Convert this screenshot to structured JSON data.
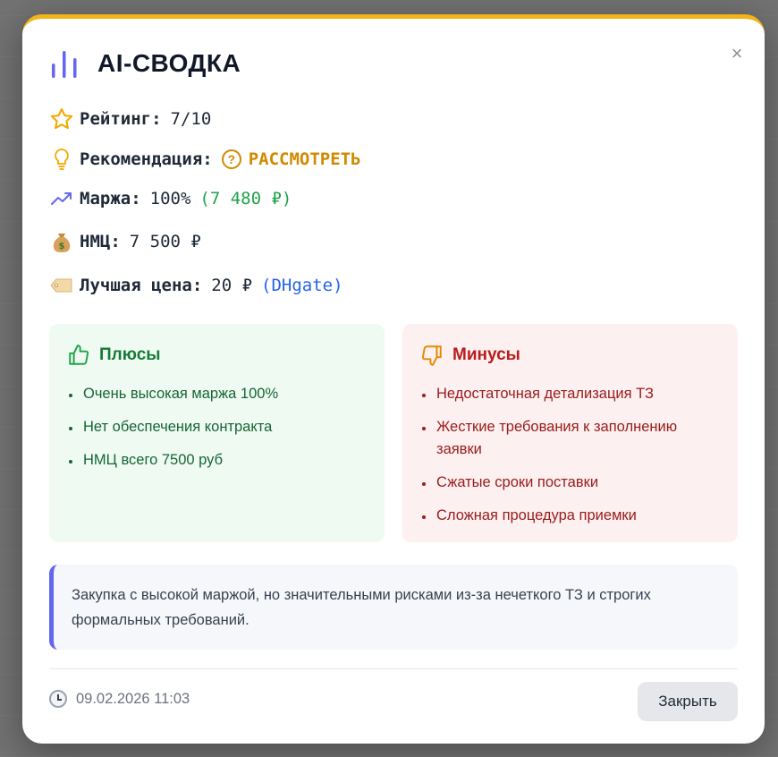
{
  "modal": {
    "title": "AI-СВОДКА",
    "close_glyph": "×",
    "accent_color": "#f2b417"
  },
  "info": {
    "rating": {
      "label": "Рейтинг:",
      "value": "7/10",
      "icon": "star-icon"
    },
    "recommendation": {
      "label": "Рекомендация:",
      "value": "РАССМОТРЕТЬ",
      "icon": "lightbulb-icon",
      "badge_icon": "question-circle-icon",
      "color": "#d18a00"
    },
    "margin": {
      "label": "Маржа:",
      "value": "100%",
      "extra": "(7 480 ₽)",
      "icon": "trending-up-icon",
      "extra_color": "#1fa34a"
    },
    "nmc": {
      "label": "НМЦ:",
      "value": "7 500 ₽",
      "icon": "money-bag-icon"
    },
    "best_price": {
      "label": "Лучшая цена:",
      "value": "20 ₽",
      "source": "(DHgate)",
      "icon": "price-tag-icon",
      "source_color": "#2563eb"
    }
  },
  "pros": {
    "title": "Плюсы",
    "icon": "thumbs-up-icon",
    "items": [
      "Очень высокая маржа 100%",
      "Нет обеспечения контракта",
      "НМЦ всего 7500 руб"
    ]
  },
  "cons": {
    "title": "Минусы",
    "icon": "thumbs-down-icon",
    "items": [
      "Недостаточная детализация ТЗ",
      "Жесткие требования к заполнению заявки",
      "Сжатые сроки поставки",
      "Сложная процедура приемки"
    ]
  },
  "summary": {
    "text": "Закупка с высокой маржой, но значительными рисками из-за нечеткого ТЗ и строгих формальных требований."
  },
  "footer": {
    "timestamp": "09.02.2026 11:03",
    "close_label": "Закрыть"
  }
}
